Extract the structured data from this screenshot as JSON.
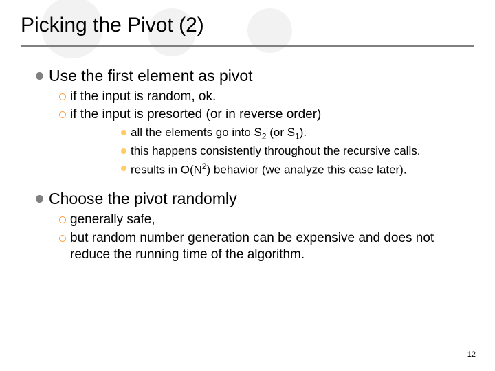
{
  "title": "Picking the Pivot (2)",
  "sections": [
    {
      "text": "Use the first element as pivot",
      "sub": [
        {
          "text": "if the input is random, ok."
        },
        {
          "text": "if the input is presorted (or in reverse order)",
          "sub": [
            {
              "html": "all the elements go into S<sub>2</sub> (or S<sub>1</sub>)."
            },
            {
              "text": "this happens consistently throughout the recursive calls."
            },
            {
              "html": "results in O(N<sup>2</sup>) behavior (we analyze this case later)."
            }
          ]
        }
      ]
    },
    {
      "text": "Choose the pivot randomly",
      "sub": [
        {
          "text": "generally safe,"
        },
        {
          "text": "but random number generation can be expensive and does not reduce the running time of the algorithm."
        }
      ]
    }
  ],
  "page_number": "12"
}
